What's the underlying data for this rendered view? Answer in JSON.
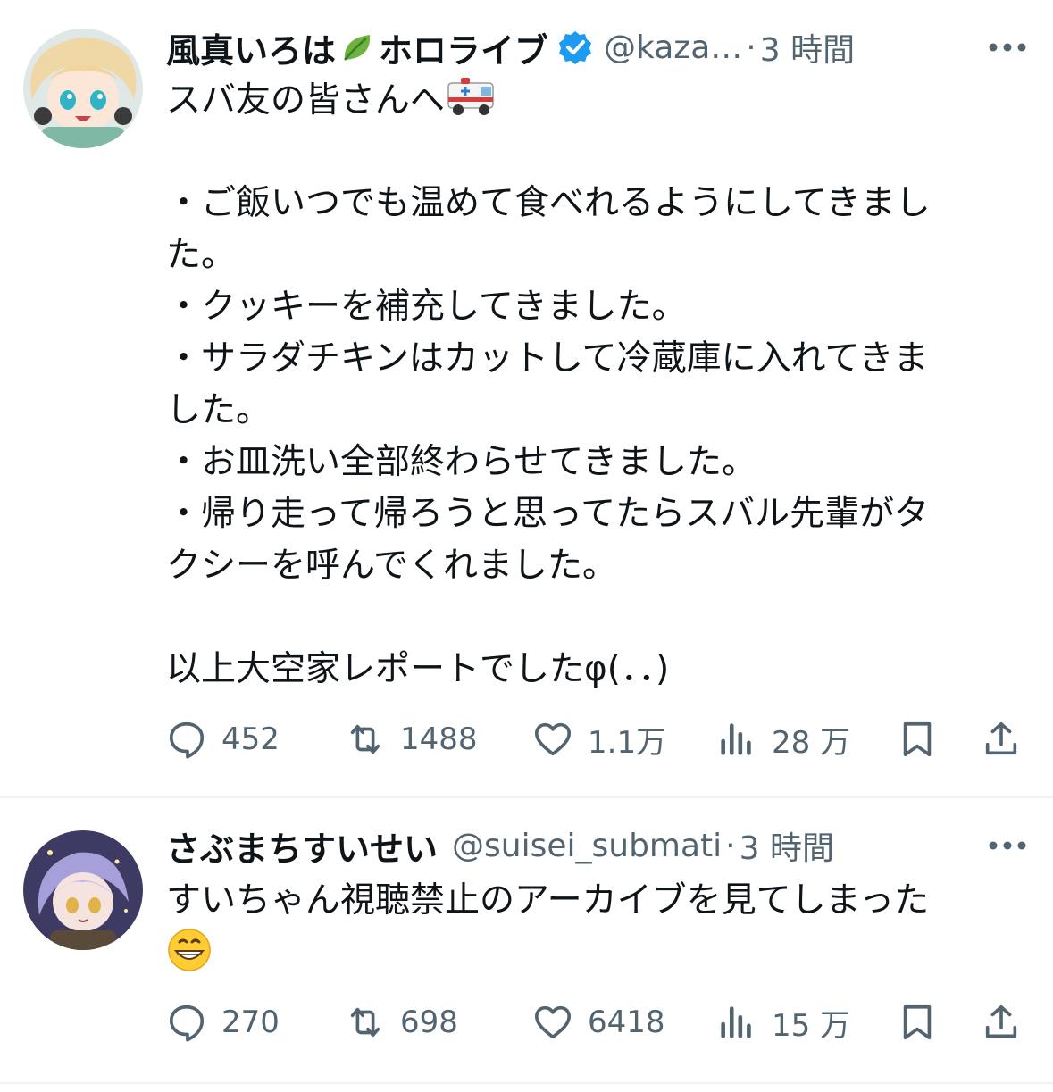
{
  "tweets": [
    {
      "name_part1": "風真いろは",
      "name_part2": "ホロライブ",
      "handle": "@kaza…",
      "separator": "·",
      "time": "3 時間",
      "lines": [
        "スバ友の皆さんへ",
        "",
        "・ご飯いつでも温めて食べれるようにしてきまし",
        "た。",
        "・クッキーを補充してきました。",
        "・サラダチキンはカットして冷蔵庫に入れてきま",
        "した。",
        "・お皿洗い全部終わらせてきました。",
        "・帰り走って帰ろうと思ってたらスバル先輩がタ",
        "クシーを呼んでくれました。",
        "",
        "以上大空家レポートでしたφ(．．)"
      ],
      "replies": "452",
      "retweets": "1488",
      "likes": "1.1万",
      "views": "28 万"
    },
    {
      "name": "さぶまちすいせい",
      "handle": "@suisei_submati",
      "separator": "·",
      "time": "3 時間",
      "lines": [
        "すいちゃん視聴禁止のアーカイブを見てしまった"
      ],
      "replies": "270",
      "retweets": "698",
      "likes": "6418",
      "views": "15 万"
    }
  ],
  "colors": {
    "text": "#0f1419",
    "secondary": "#536471",
    "verified": "#1d9bf0",
    "divider": "#eff3f4"
  },
  "icons": [
    "more-icon",
    "reply-icon",
    "retweet-icon",
    "like-icon",
    "views-icon",
    "bookmark-icon",
    "share-icon",
    "verified-badge-icon",
    "leaf-emoji",
    "ambulance-emoji",
    "grinning-face-emoji"
  ]
}
